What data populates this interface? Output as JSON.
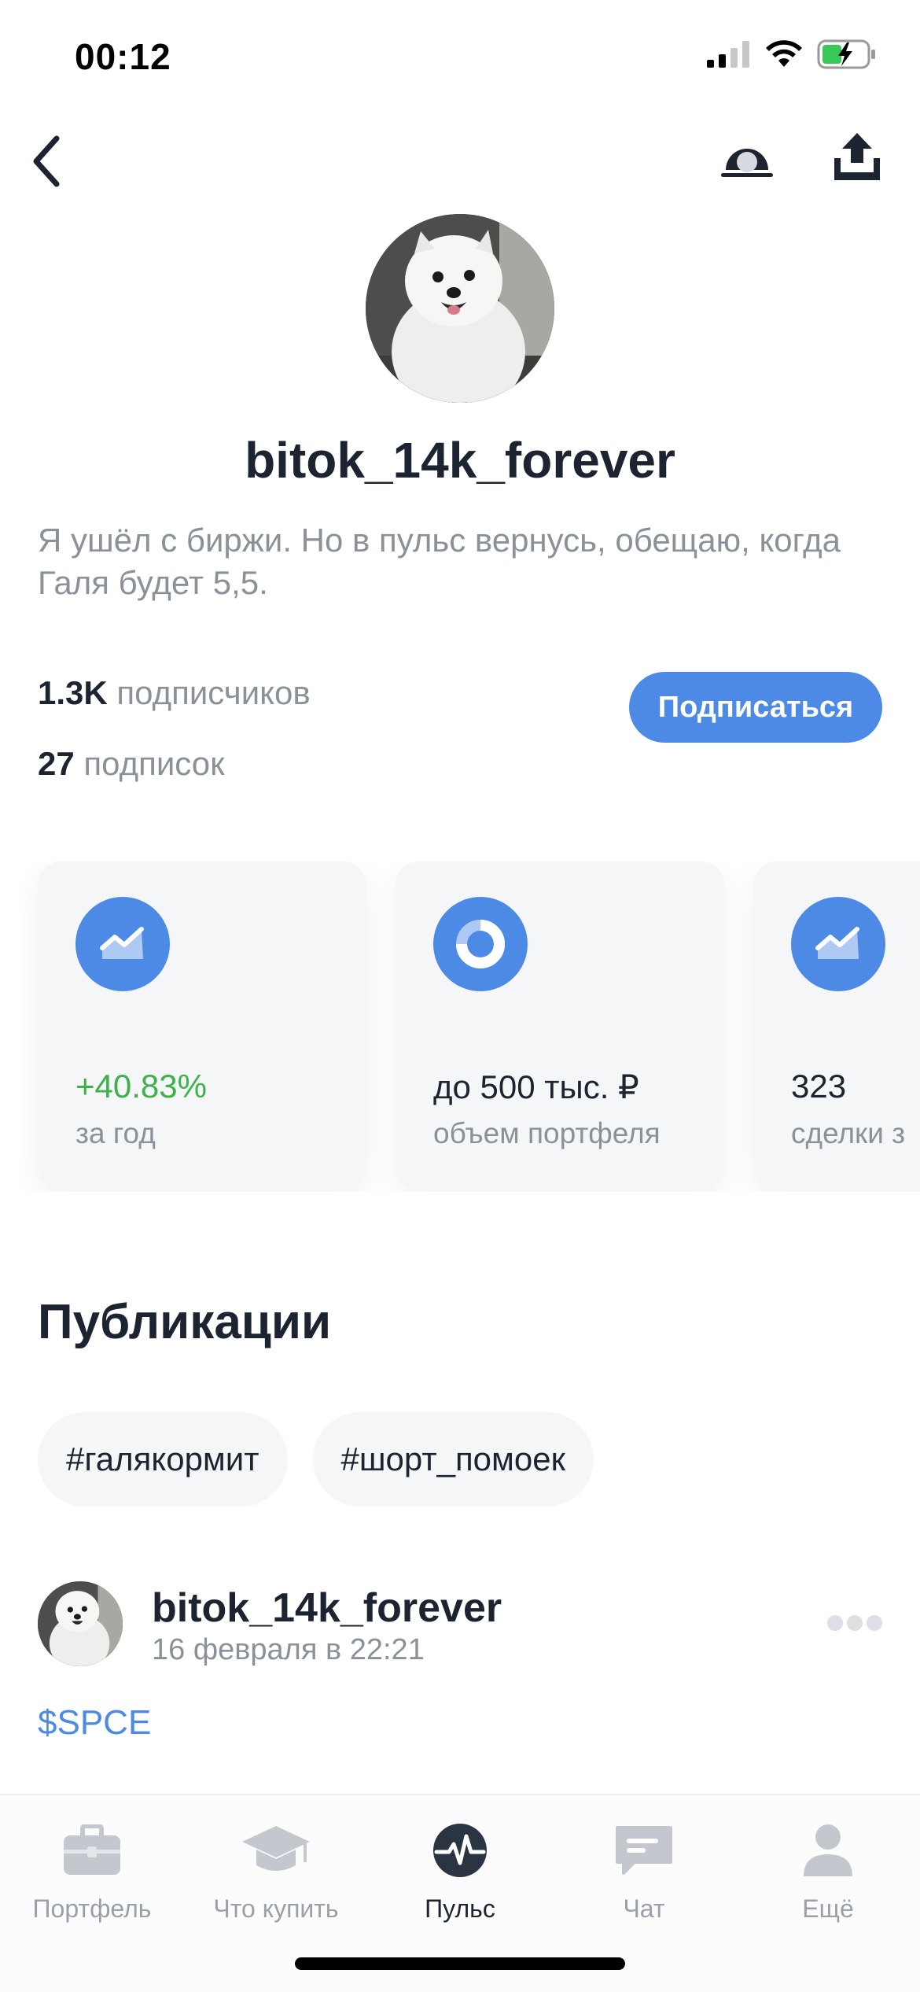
{
  "status": {
    "time": "00:12"
  },
  "profile": {
    "username": "bitok_14k_forever",
    "bio": "Я ушёл с биржи. Но в пульс вернусь, обещаю, когда Галя будет 5,5.",
    "followers_count": "1.3K",
    "followers_label": "подписчиков",
    "following_count": "27",
    "following_label": "подписок",
    "subscribe_label": "Подписаться"
  },
  "cards": [
    {
      "icon": "chart-trend-icon",
      "value": "+40.83%",
      "label": "за год"
    },
    {
      "icon": "pie-chart-icon",
      "value": "до 500 тыс. ₽",
      "label": "объем портфеля"
    },
    {
      "icon": "chart-trend-icon",
      "value": "323",
      "label": "сделки з"
    }
  ],
  "publications": {
    "title": "Публикации",
    "tags": [
      "#галякормит",
      "#шорт_помоек"
    ]
  },
  "post": {
    "author": "bitok_14k_forever",
    "date": "16 февраля в 22:21",
    "ticker": "$SPCE"
  },
  "tabs": [
    {
      "label": "Портфель",
      "icon": "briefcase-icon",
      "active": false
    },
    {
      "label": "Что купить",
      "icon": "graduation-cap-icon",
      "active": false
    },
    {
      "label": "Пульс",
      "icon": "pulse-icon",
      "active": true
    },
    {
      "label": "Чат",
      "icon": "chat-icon",
      "active": false
    },
    {
      "label": "Ещё",
      "icon": "person-icon",
      "active": false
    }
  ],
  "colors": {
    "accent": "#4d8ae6",
    "positive": "#3fb04a",
    "text_primary": "#1c2431",
    "text_secondary": "#8b9199"
  }
}
